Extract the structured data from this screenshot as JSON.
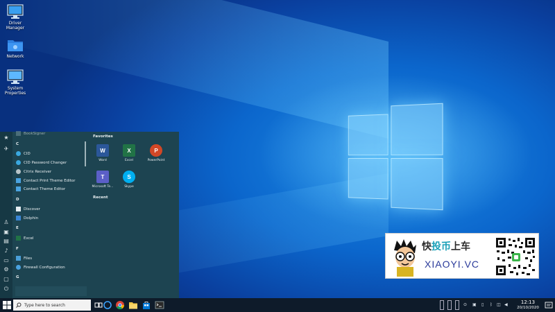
{
  "desktop": {
    "icons": [
      {
        "label": "Driver Manager",
        "icon": "monitor-icon"
      },
      {
        "label": "Network",
        "icon": "network-folder-icon"
      },
      {
        "label": "System Properties",
        "icon": "computer-icon"
      }
    ]
  },
  "start_menu": {
    "apps": {
      "partial_item": "BookSigner",
      "letters": [
        "C",
        "D",
        "E",
        "F",
        "G"
      ],
      "items": [
        {
          "letter": "C",
          "label": "CID",
          "icon": "cid-icon"
        },
        {
          "letter": "C",
          "label": "CID Password Changer",
          "icon": "cid-password-icon"
        },
        {
          "letter": "C",
          "label": "Citrix Receiver",
          "icon": "citrix-icon"
        },
        {
          "letter": "C",
          "label": "Contact Print Theme Editor",
          "icon": "theme-editor-icon"
        },
        {
          "letter": "C",
          "label": "Contact Theme Editor",
          "icon": "theme-editor-icon"
        },
        {
          "letter": "D",
          "label": "Discover",
          "icon": "discover-icon"
        },
        {
          "letter": "D",
          "label": "Dolphin",
          "icon": "dolphin-icon"
        },
        {
          "letter": "E",
          "label": "Excel",
          "icon": "excel-icon"
        },
        {
          "letter": "F",
          "label": "Files",
          "icon": "files-icon"
        },
        {
          "letter": "F",
          "label": "Firewall Configuration",
          "icon": "firewall-icon"
        }
      ]
    },
    "favorites": {
      "title": "Favorites",
      "tiles": [
        {
          "label": "Word",
          "glyph": "W",
          "color": "#2b579a"
        },
        {
          "label": "Excel",
          "glyph": "X",
          "color": "#217346"
        },
        {
          "label": "PowerPoint",
          "glyph": "P",
          "color": "#d24726"
        },
        {
          "label": "Microsoft Te...",
          "glyph": "T",
          "color": "#5b5fc7"
        },
        {
          "label": "Skype",
          "glyph": "S",
          "color": "#00aff0"
        }
      ]
    },
    "recent": {
      "title": "Recent"
    }
  },
  "taskbar": {
    "search_placeholder": "Type here to search",
    "time": "12:13",
    "date": "20/10/2020"
  },
  "watermark": {
    "brand_cn_a": "快",
    "brand_cn_b": "投币",
    "brand_cn_c": "上车",
    "brand_en": "XIAOYI.VC"
  },
  "colors": {
    "start_bg": "#1d4451",
    "rail_bg": "#163844",
    "taskbar_bg": "#0e1b2a",
    "desktop_blue": "#0b66cc"
  }
}
